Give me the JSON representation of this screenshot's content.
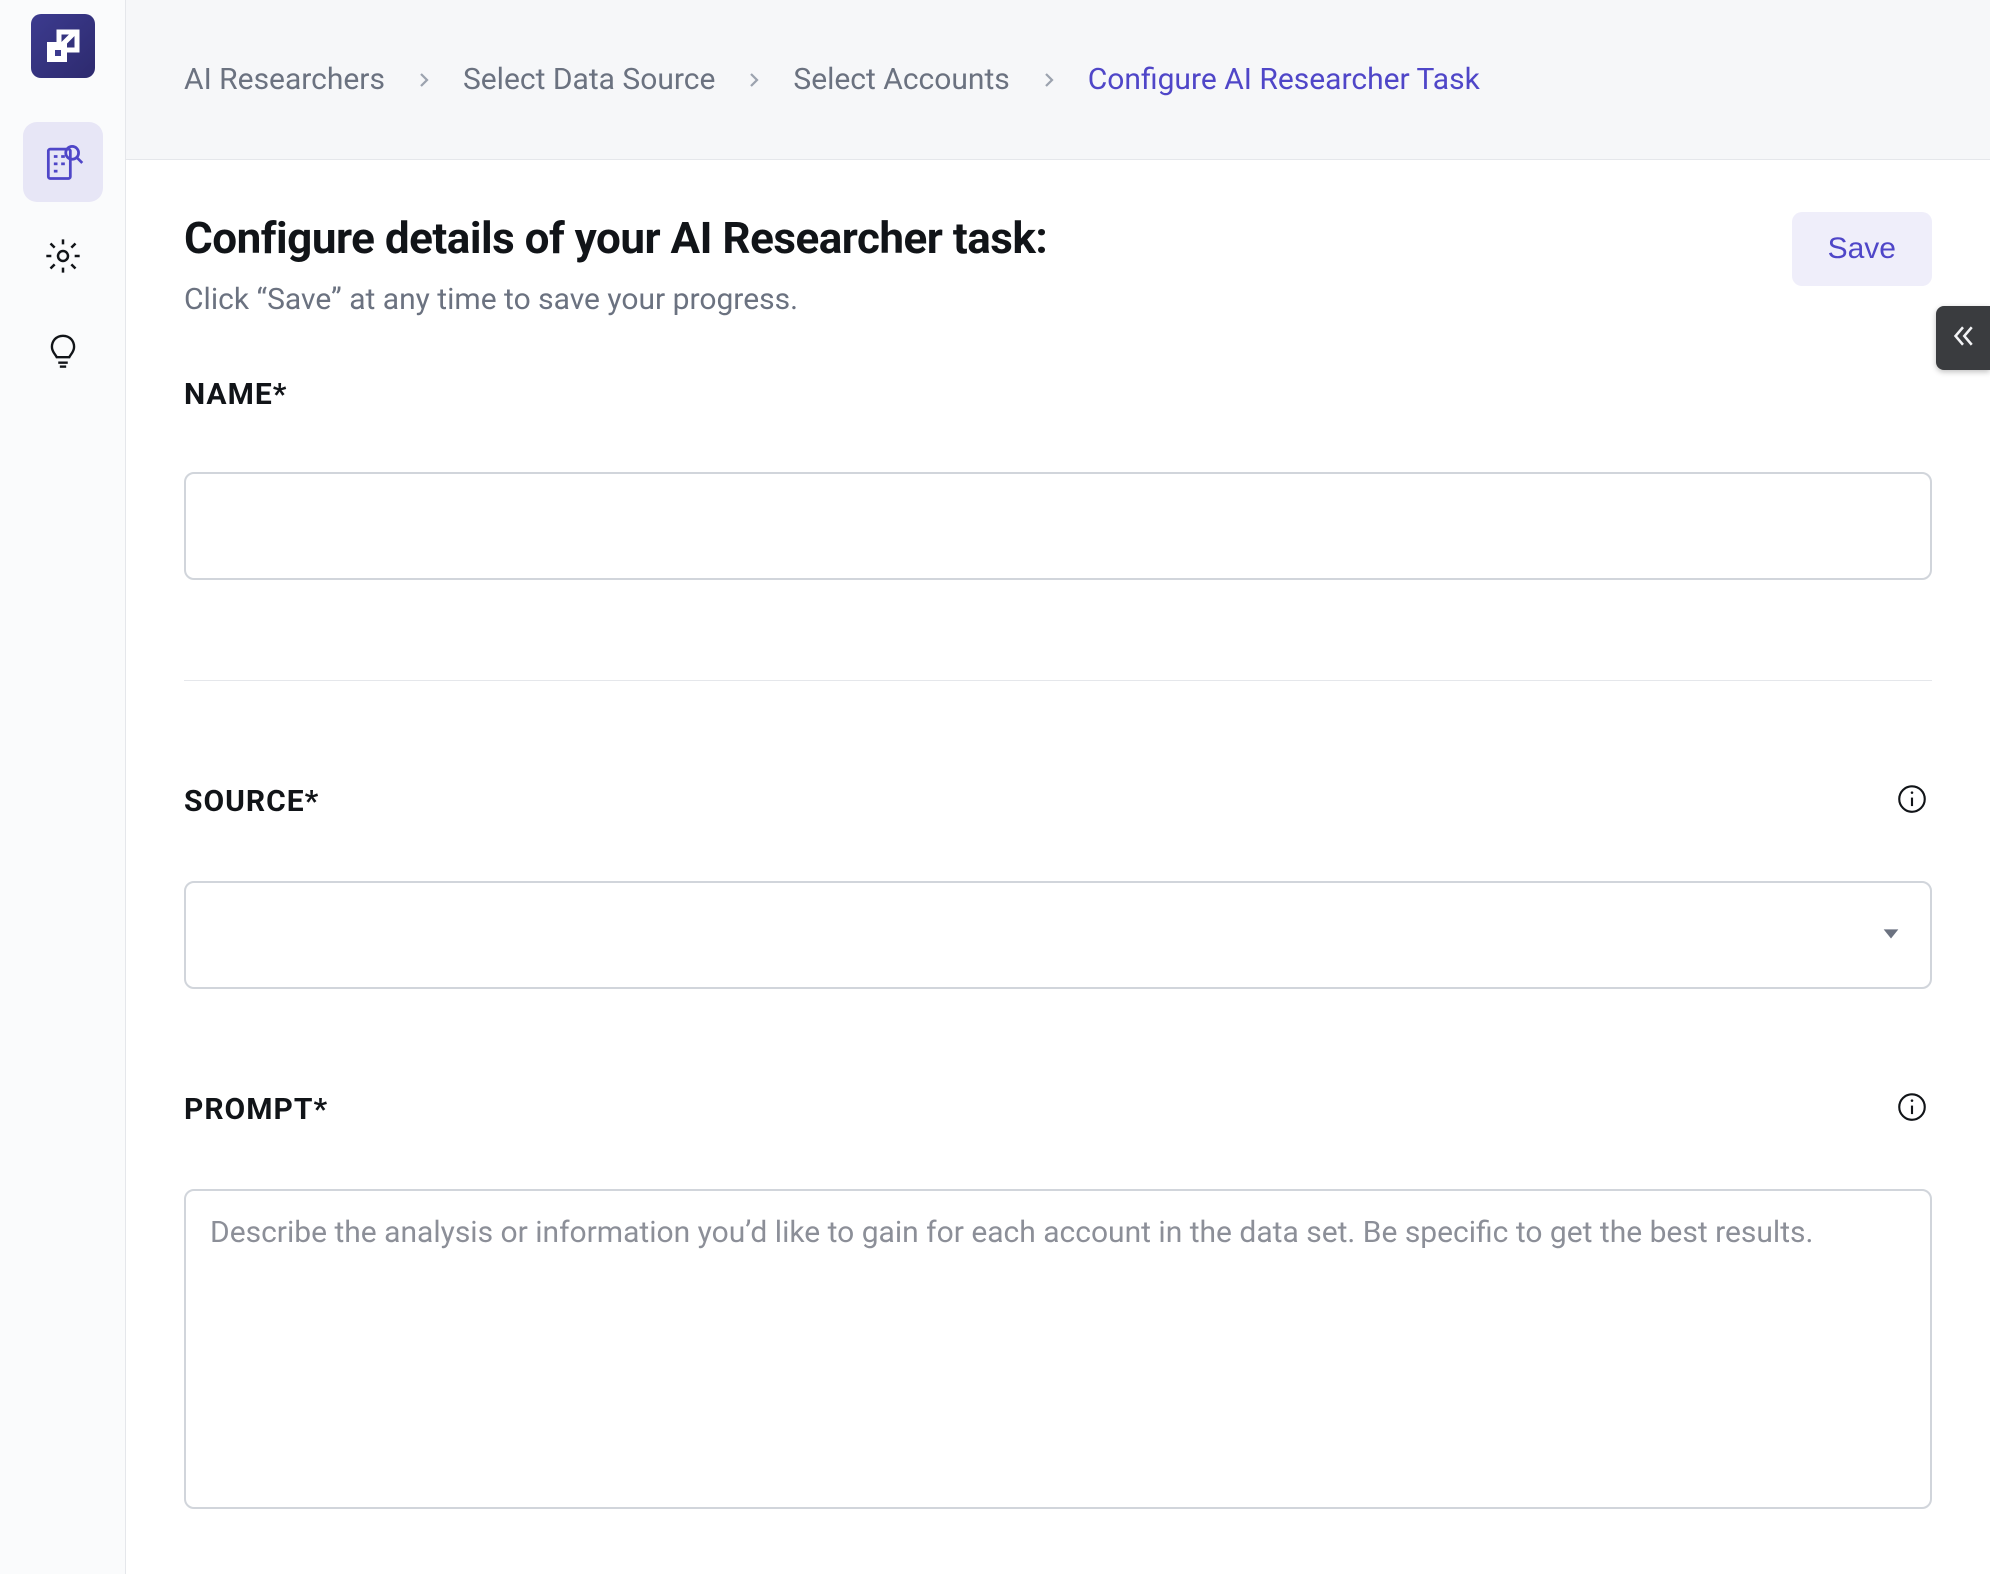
{
  "breadcrumb": {
    "items": [
      {
        "label": "AI Researchers",
        "current": false
      },
      {
        "label": "Select Data Source",
        "current": false
      },
      {
        "label": "Select Accounts",
        "current": false
      },
      {
        "label": "Configure AI Researcher Task",
        "current": true
      }
    ]
  },
  "header": {
    "title": "Configure details of your AI Researcher task:",
    "subtitle": "Click “Save” at any time to save your progress.",
    "save_label": "Save"
  },
  "fields": {
    "name": {
      "label": "NAME",
      "required_mark": "*",
      "value": ""
    },
    "source": {
      "label": "SOURCE",
      "required_mark": "*",
      "value": ""
    },
    "prompt": {
      "label": "PROMPT",
      "required_mark": "*",
      "value": "",
      "placeholder": "Describe the analysis or information you’d like to gain for each account in the data set. Be specific to get the best results."
    }
  },
  "sidebar": {
    "items": [
      {
        "id": "logo",
        "icon": "logo-icon"
      },
      {
        "id": "ai-researchers",
        "icon": "building-search-icon",
        "active": true
      },
      {
        "id": "settings",
        "icon": "gear-icon",
        "active": false
      },
      {
        "id": "tips",
        "icon": "lightbulb-icon",
        "active": false
      }
    ]
  },
  "colors": {
    "accent": "#4F46C8",
    "accent_bg": "#EFEEFA",
    "border": "#D1D5DB",
    "text_muted": "#6B7280"
  }
}
